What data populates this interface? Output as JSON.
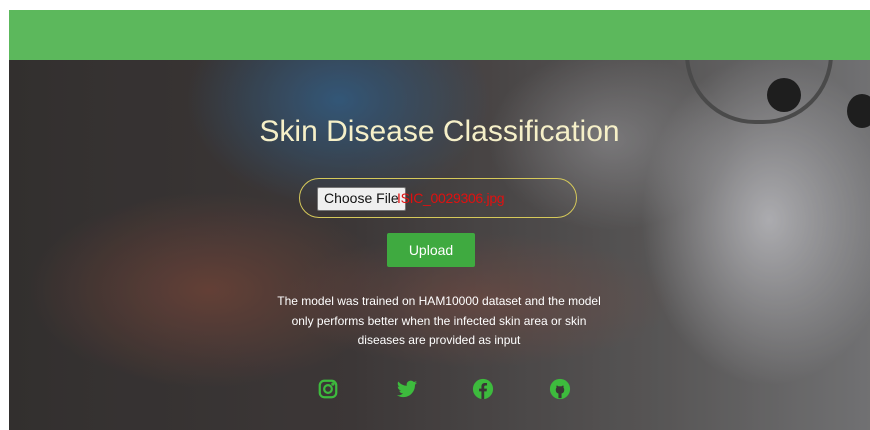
{
  "header": {
    "bar_color": "#5cb85c"
  },
  "main": {
    "title": "Skin Disease Classification",
    "file_input": {
      "button_label": "Choose File",
      "file_name": "ISIC_0029306.jpg"
    },
    "upload_button": "Upload",
    "description": "The model was trained on HAM10000 dataset and the model only performs better when the infected skin area or skin diseases are provided as input"
  },
  "social_icons": [
    "instagram-icon",
    "twitter-icon",
    "facebook-icon",
    "github-icon"
  ],
  "colors": {
    "accent_green": "#3faa40",
    "title_color": "#f6f0c8",
    "file_name_color": "#e01010",
    "icon_color": "#3dbb3d"
  }
}
